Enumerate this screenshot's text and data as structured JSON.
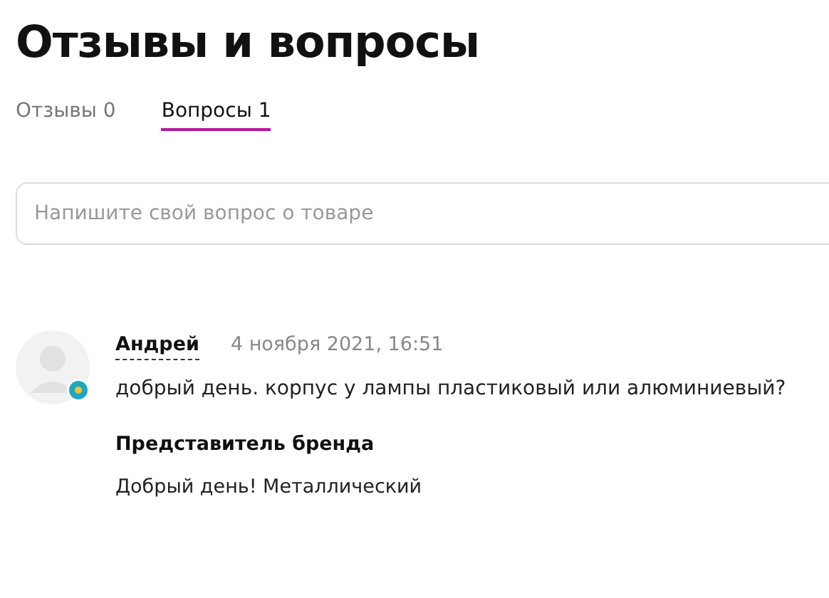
{
  "title": "Отзывы и вопросы",
  "tabs": [
    {
      "label": "Отзывы 0",
      "selected": false
    },
    {
      "label": "Вопросы 1",
      "selected": true
    }
  ],
  "search": {
    "placeholder": "Напишите свой вопрос о товаре"
  },
  "questions": [
    {
      "author": "Андрей",
      "date": "4 ноября 2021, 16:51",
      "text": "добрый день. корпус у лампы пластиковый или алюминиевый?",
      "answer": {
        "author": "Представитель бренда",
        "text": "Добрый день! Металлический"
      }
    }
  ]
}
